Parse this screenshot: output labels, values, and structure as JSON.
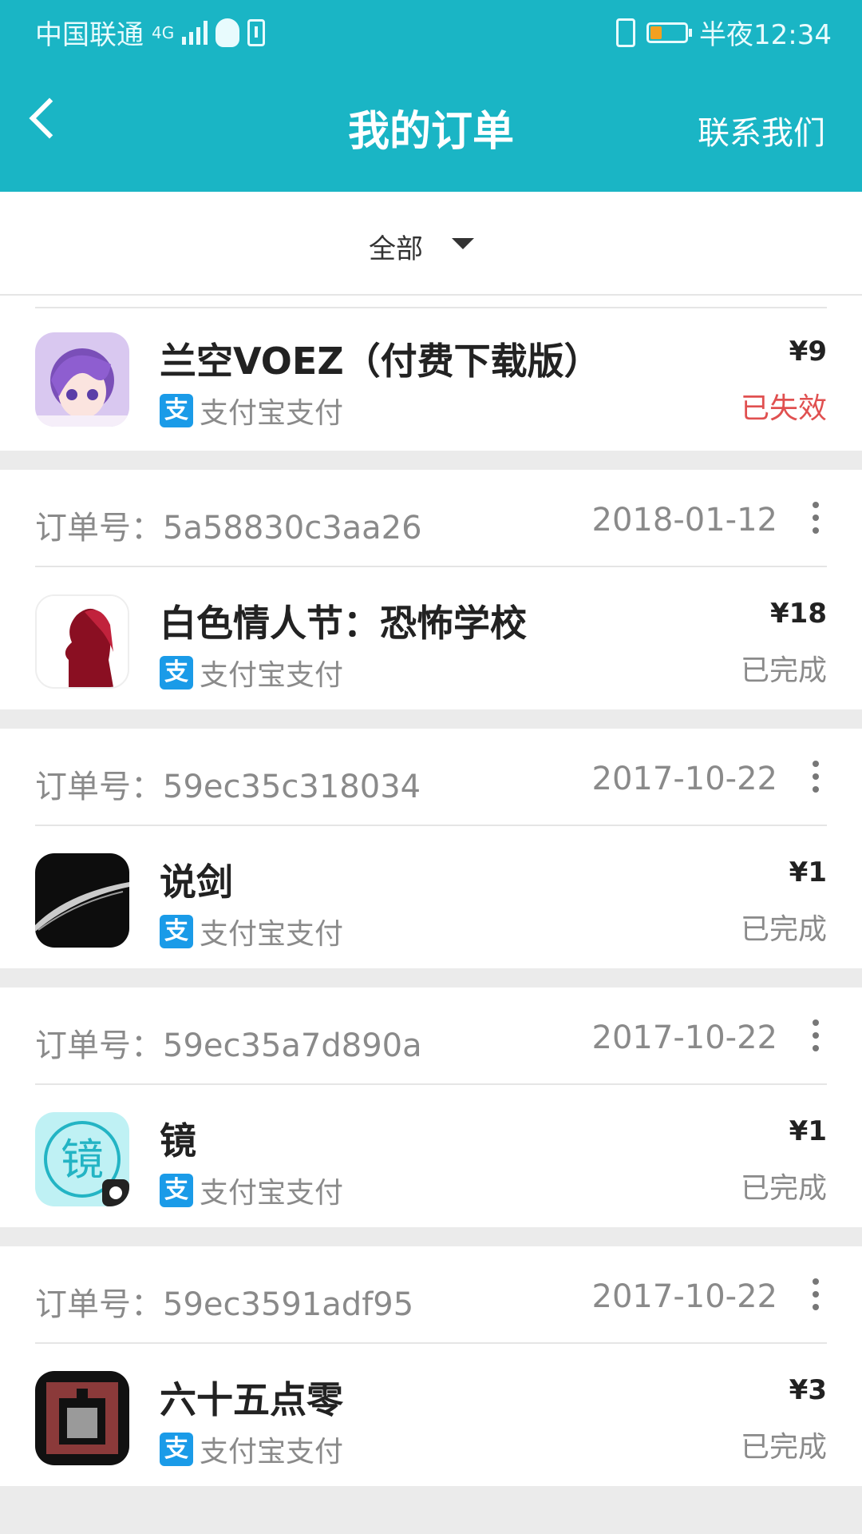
{
  "statusbar": {
    "carrier": "中国联通",
    "network": "4G",
    "time": "半夜12:34"
  },
  "header": {
    "title": "我的订单",
    "contact_label": "联系我们"
  },
  "filter": {
    "label": "全部"
  },
  "payment_method_label": "支付宝支付",
  "alipay_glyph": "支",
  "orders": [
    {
      "app_name": "兰空VOEZ（付费下载版）",
      "price": "¥9",
      "status": "已失效"
    },
    {
      "order_label": "订单号：",
      "order_no": "5a58830c3aa26",
      "date": "2018-01-12",
      "app_name": "白色情人节：恐怖学校",
      "price": "¥18",
      "status": "已完成"
    },
    {
      "order_label": "订单号：",
      "order_no": "59ec35c318034",
      "date": "2017-10-22",
      "app_name": "说剑",
      "price": "¥1",
      "status": "已完成"
    },
    {
      "order_label": "订单号：",
      "order_no": "59ec35a7d890a",
      "date": "2017-10-22",
      "app_name": "镜",
      "price": "¥1",
      "status": "已完成"
    },
    {
      "order_label": "订单号：",
      "order_no": "59ec3591adf95",
      "date": "2017-10-22",
      "app_name": "六十五点零",
      "price": "¥3",
      "status": "已完成"
    }
  ],
  "icon_glyphs": {
    "mirror": "镜"
  }
}
